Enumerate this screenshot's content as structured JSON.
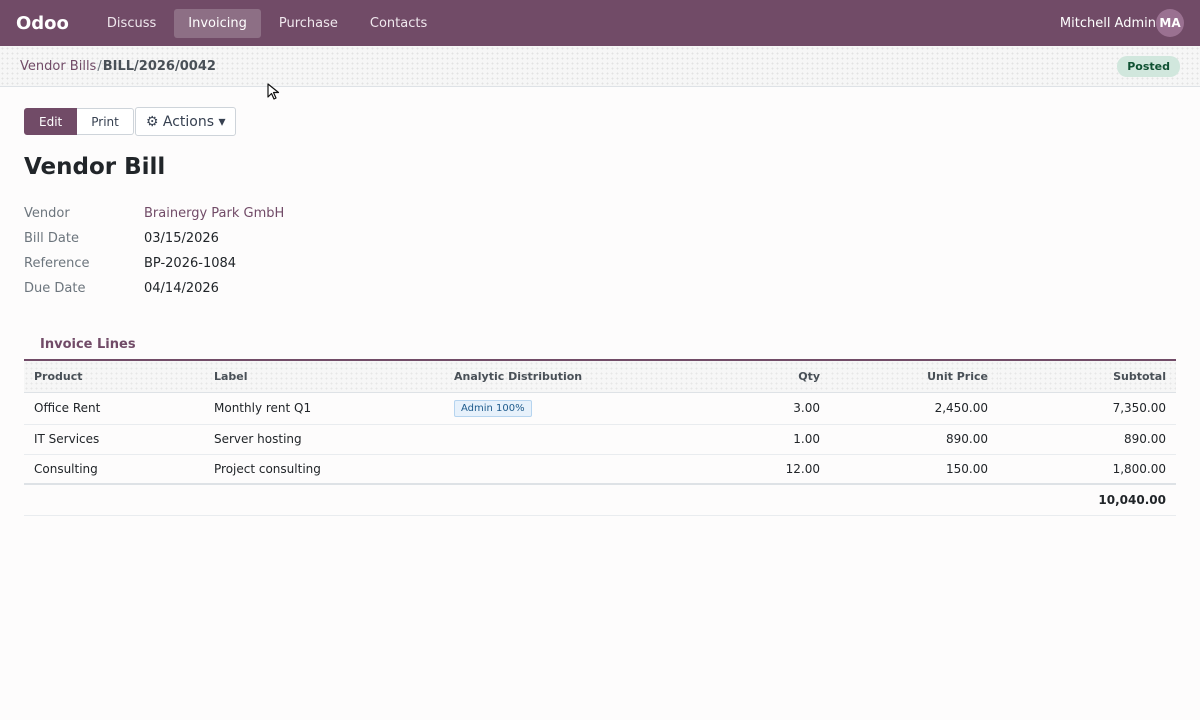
{
  "app": {
    "logo": "Odoo",
    "menu": [
      "Discuss",
      "Invoicing",
      "Purchase",
      "Contacts"
    ],
    "active_menu": "Invoicing",
    "user_name": "Mitchell Admin",
    "user_initials": "MA"
  },
  "breadcrumb": {
    "parent": "Vendor Bills",
    "separator": "/",
    "current": "BILL/2026/0042"
  },
  "status": "Posted",
  "toolbar": {
    "edit_label": "Edit",
    "print_label": "Print",
    "actions_label": "⚙ Actions ▾"
  },
  "form": {
    "title": "Vendor Bill",
    "fields": [
      {
        "label": "Vendor",
        "value": "Brainergy Park GmbH"
      },
      {
        "label": "Bill Date",
        "value": "03/15/2026"
      },
      {
        "label": "Reference",
        "value": "BP-2026-1084"
      },
      {
        "label": "Due Date",
        "value": "04/14/2026"
      }
    ]
  },
  "tab_label": "Invoice Lines",
  "lines": {
    "columns": [
      "Product",
      "Label",
      "Analytic Distribution",
      "Qty",
      "Unit Price",
      "Subtotal"
    ],
    "rows": [
      {
        "product": "Office Rent",
        "label": "Monthly rent Q1",
        "analytic": "Admin 100%",
        "qty": "3.00",
        "unit_price": "2,450.00",
        "subtotal": "7,350.00"
      },
      {
        "product": "IT Services",
        "label": "Server hosting",
        "analytic": "",
        "qty": "1.00",
        "unit_price": "890.00",
        "subtotal": "890.00"
      },
      {
        "product": "Consulting",
        "label": "Project consulting",
        "analytic": "",
        "qty": "12.00",
        "unit_price": "150.00",
        "subtotal": "1,800.00"
      }
    ],
    "total": "10,040.00"
  },
  "colors": {
    "brand": "#714b67",
    "status_bg": "#d1e7dd",
    "status_fg": "#0f5132"
  }
}
